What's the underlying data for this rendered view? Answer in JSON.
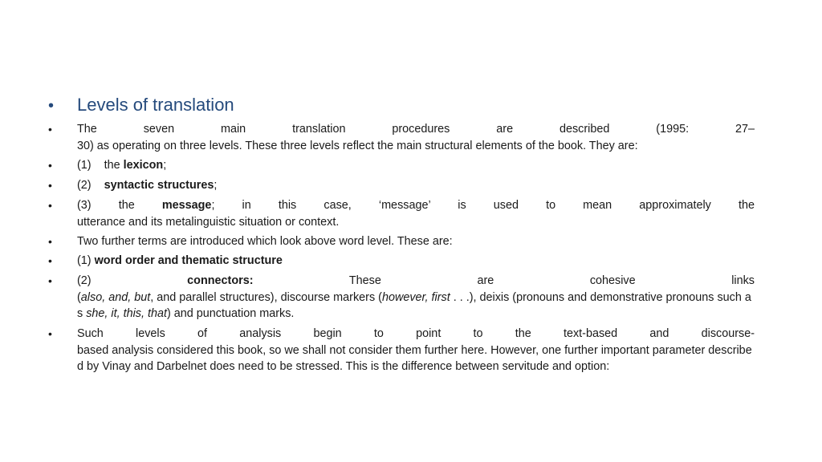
{
  "slide": {
    "bullet_glyph": "•",
    "title": {
      "text": "Levels  of translation",
      "color": "#254a7c"
    },
    "items": [
      {
        "id": "procedures",
        "line1": "The seven main translation procedures are described (1995: 27–",
        "rest": "30) as operating on three levels. These three levels reflect the main structural elements  of the book. They are:"
      },
      {
        "id": "lexicon",
        "prefix": "(1)    the ",
        "bold": "lexicon",
        "suffix": ";"
      },
      {
        "id": "syntactic",
        "prefix": "(2)    ",
        "bold": "syntactic structures",
        "suffix": ";"
      },
      {
        "id": "message",
        "line1_prefix": "(3)  the ",
        "line1_bold": "message",
        "line1_suffix": "; in this case, ‘message’ is used to mean approximately the",
        "rest": "utterance and its metalinguistic situation or context."
      },
      {
        "id": "further-terms",
        "text": "Two further terms are introduced  which look above word level. These are:"
      },
      {
        "id": "word-order",
        "prefix": "(1) ",
        "bold": "word order and thematic structure"
      },
      {
        "id": "connectors",
        "line1_prefix": "(2) ",
        "line1_bold": "connectors:",
        "line1_suffix": " These are cohesive links",
        "rest_parts": [
          {
            "t": "(",
            "s": "n"
          },
          {
            "t": "also, and, but",
            "s": "i"
          },
          {
            "t": ", and parallel structures), discourse markers (",
            "s": "n"
          },
          {
            "t": "however,  first",
            "s": "i"
          },
          {
            "t": " . . .), deixis (pronouns  and demonstrative  pronouns  such  as ",
            "s": "n"
          },
          {
            "t": "she, it, this, that",
            "s": "i"
          },
          {
            "t": ") and punctuation  marks.",
            "s": "n"
          }
        ]
      },
      {
        "id": "such-levels",
        "line1": "Such levels of analysis begin to point to the text-based and discourse-",
        "rest": "based analysis considered this book, so we shall not consider them further here. However, one further important parameter  described by Vinay and Darbelnet does need to be stressed. This is the difference between servitude and option:"
      }
    ]
  }
}
